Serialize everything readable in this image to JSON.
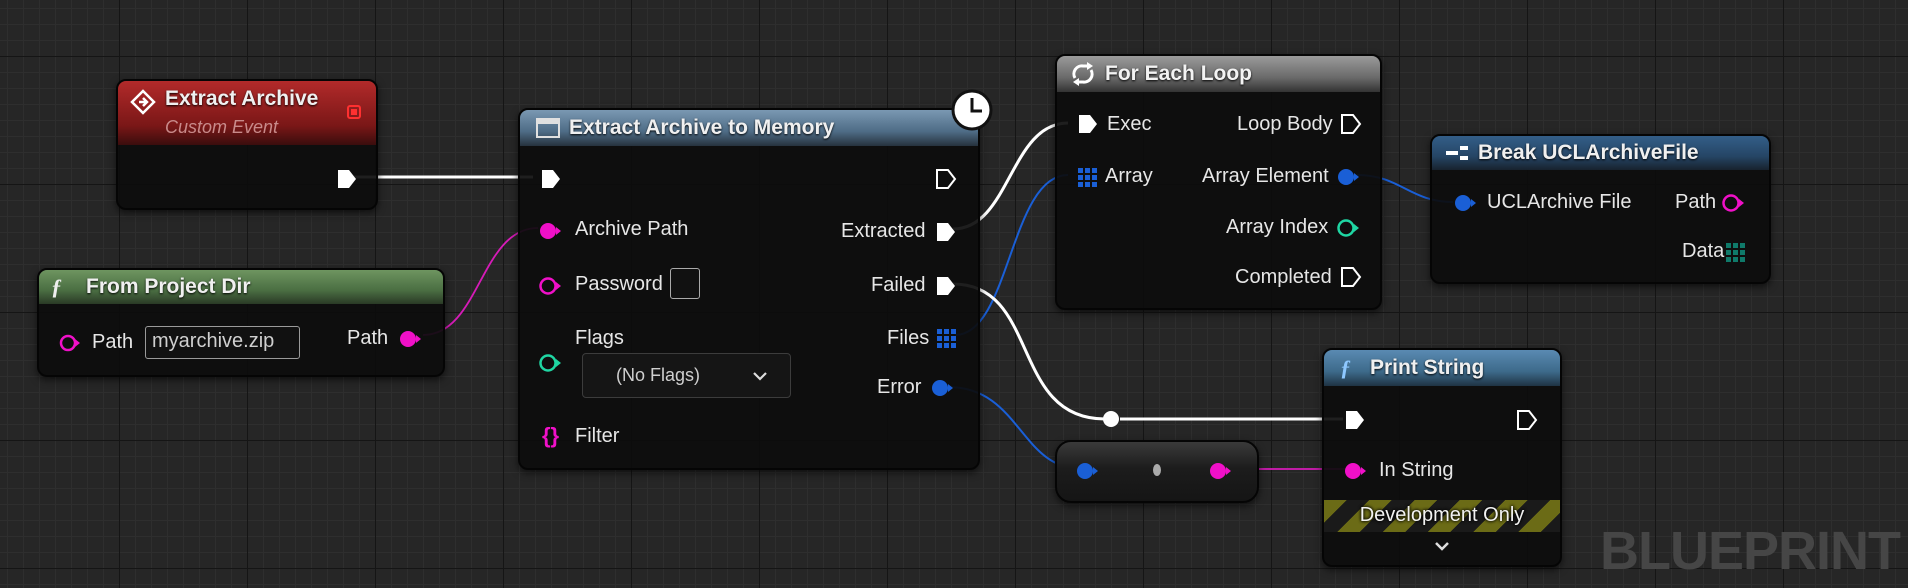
{
  "nodes": {
    "extract_archive_event": {
      "title": "Extract Archive",
      "subtitle": "Custom Event",
      "header_color": "#8a1c1c"
    },
    "from_project_dir": {
      "title": "From Project Dir",
      "header_color": "#4f6e45",
      "input_path_label": "Path",
      "input_path_value": "myarchive.zip",
      "output_path_label": "Path"
    },
    "extract_to_memory": {
      "title": "Extract Archive to Memory",
      "header_color": "#4a6a85",
      "inputs": {
        "archive_path": "Archive Path",
        "password": "Password",
        "flags": "Flags",
        "flags_value": "(No Flags)",
        "filter": "Filter"
      },
      "outputs": {
        "extracted": "Extracted",
        "failed": "Failed",
        "files": "Files",
        "error": "Error"
      }
    },
    "for_each_loop": {
      "title": "For Each Loop",
      "header_color": "#5a5a5a",
      "inputs": {
        "exec": "Exec",
        "array": "Array"
      },
      "outputs": {
        "loop_body": "Loop Body",
        "array_element": "Array Element",
        "array_index": "Array Index",
        "completed": "Completed"
      }
    },
    "break_ucl_archive_file": {
      "title": "Break UCLArchiveFile",
      "header_color": "#2c4d6e",
      "input": "UCLArchive File",
      "outputs": {
        "path": "Path",
        "data": "Data"
      }
    },
    "print_string": {
      "title": "Print String",
      "header_color": "#3d6a8a",
      "input": "In String",
      "banner": "Development Only"
    }
  },
  "watermark": "BLUEPRINT",
  "colors": {
    "exec": "#ffffff",
    "string": "#f010c8",
    "struct": "#1a5fd6",
    "integer": "#1fd6a3",
    "array_struct": "#1a5fd6",
    "array_byte": "#0f7a6a"
  },
  "icons": {
    "event": "event-diamond-icon",
    "function": "function-f-icon",
    "macro_loop": "loop-arrows-icon",
    "break_struct": "break-struct-icon",
    "latent": "clock-icon",
    "delegate": "curly-braces-icon",
    "expand": "chevron-down-icon"
  }
}
